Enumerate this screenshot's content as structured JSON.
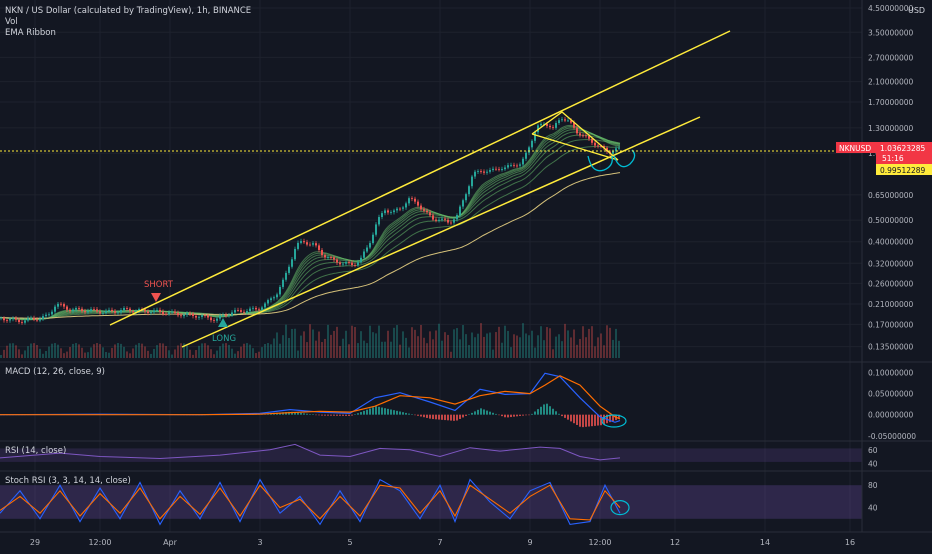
{
  "header": {
    "symbol_line": "NKN / US Dollar (calculated by TradingView), 1h, BINANCE",
    "vol_label": "Vol",
    "ema_label": "EMA Ribbon",
    "currency": "USD"
  },
  "indicators": {
    "macd_label": "MACD (12, 26, close, 9)",
    "rsi_label": "RSI (14, close)",
    "stoch_label": "Stoch RSI (3, 3, 14, 14, close)"
  },
  "annotations": {
    "short_label": "SHORT",
    "long_label": "LONG"
  },
  "price_badges": {
    "ticker": "NKNUSD",
    "price": "1.03623285",
    "countdown": "51:16",
    "ema_value": "0.99512289"
  },
  "colors": {
    "background": "#131722",
    "up": "#26a69a",
    "down": "#ef5350",
    "channel": "#ffeb3b",
    "ribbon": "#66bb6a",
    "macd": "#2962ff",
    "signal": "#ff6d00",
    "rsi": "#7e57c2",
    "stoch_k": "#2962ff",
    "stoch_d": "#ff6d00",
    "circle": "#00bcd4",
    "price_badge": "#f23645"
  },
  "chart_data": [
    {
      "type": "candlestick",
      "yscale": "log",
      "ylim": [
        0.12,
        4.5
      ],
      "y_ticks": [
        "4.50000000",
        "3.50000000",
        "2.70000000",
        "2.10000000",
        "1.70000000",
        "1.30000000",
        "1.00000000",
        "0.65000000",
        "0.50000000",
        "0.40000000",
        "0.32000000",
        "0.26000000",
        "0.21000000",
        "0.17000000",
        "0.13500000"
      ],
      "x_ticks": [
        "29",
        "12:00",
        "Apr",
        "3",
        "5",
        "7",
        "9",
        "12:00",
        "12",
        "14",
        "16"
      ],
      "series": [
        {
          "name": "NKNUSD",
          "points": [
            [
              0,
              0.182
            ],
            [
              10,
              0.178
            ],
            [
              22,
              0.176
            ],
            [
              33,
              0.18
            ],
            [
              40,
              0.181
            ],
            [
              47,
              0.186
            ],
            [
              55,
              0.21
            ],
            [
              62,
              0.204
            ],
            [
              70,
              0.198
            ],
            [
              82,
              0.197
            ],
            [
              95,
              0.195
            ],
            [
              105,
              0.193
            ],
            [
              115,
              0.195
            ],
            [
              125,
              0.198
            ],
            [
              135,
              0.196
            ],
            [
              148,
              0.195
            ],
            [
              160,
              0.193
            ],
            [
              172,
              0.19
            ],
            [
              184,
              0.188
            ],
            [
              196,
              0.186
            ],
            [
              208,
              0.182
            ],
            [
              215,
              0.178
            ],
            [
              222,
              0.186
            ],
            [
              232,
              0.193
            ],
            [
              244,
              0.196
            ],
            [
              256,
              0.199
            ],
            [
              266,
              0.212
            ],
            [
              276,
              0.236
            ],
            [
              283,
              0.27
            ],
            [
              290,
              0.33
            ],
            [
              295,
              0.385
            ],
            [
              302,
              0.4
            ],
            [
              312,
              0.39
            ],
            [
              322,
              0.35
            ],
            [
              332,
              0.33
            ],
            [
              342,
              0.32
            ],
            [
              352,
              0.315
            ],
            [
              360,
              0.335
            ],
            [
              368,
              0.39
            ],
            [
              376,
              0.49
            ],
            [
              384,
              0.56
            ],
            [
              392,
              0.54
            ],
            [
              400,
              0.57
            ],
            [
              408,
              0.62
            ],
            [
              416,
              0.6
            ],
            [
              424,
              0.54
            ],
            [
              432,
              0.51
            ],
            [
              440,
              0.5
            ],
            [
              448,
              0.49
            ],
            [
              456,
              0.52
            ],
            [
              464,
              0.65
            ],
            [
              472,
              0.8
            ],
            [
              480,
              0.84
            ],
            [
              488,
              0.82
            ],
            [
              496,
              0.86
            ],
            [
              504,
              0.85
            ],
            [
              512,
              0.9
            ],
            [
              520,
              0.88
            ],
            [
              528,
              1.08
            ],
            [
              536,
              1.3
            ],
            [
              544,
              1.38
            ],
            [
              552,
              1.28
            ],
            [
              560,
              1.46
            ],
            [
              568,
              1.38
            ],
            [
              576,
              1.25
            ],
            [
              584,
              1.18
            ],
            [
              592,
              1.12
            ],
            [
              600,
              1.06
            ],
            [
              608,
              1.01
            ],
            [
              614,
              1.04
            ],
            [
              620,
              1.036
            ]
          ]
        }
      ]
    },
    {
      "type": "line",
      "name": "MACD (12, 26, close, 9)",
      "ylim": [
        -0.06,
        0.12
      ],
      "y_ticks": [
        "0.10000000",
        "0.05000000",
        "0.00000000",
        "-0.05000000"
      ],
      "series": [
        {
          "name": "MACD",
          "points": [
            [
              0,
              0.0
            ],
            [
              100,
              0.001
            ],
            [
              200,
              0.0
            ],
            [
              260,
              0.003
            ],
            [
              290,
              0.012
            ],
            [
              320,
              0.006
            ],
            [
              350,
              0.003
            ],
            [
              375,
              0.04
            ],
            [
              400,
              0.052
            ],
            [
              430,
              0.03
            ],
            [
              455,
              0.01
            ],
            [
              480,
              0.06
            ],
            [
              505,
              0.048
            ],
            [
              530,
              0.05
            ],
            [
              545,
              0.098
            ],
            [
              560,
              0.09
            ],
            [
              580,
              0.04
            ],
            [
              600,
              -0.005
            ],
            [
              615,
              -0.018
            ],
            [
              620,
              -0.014
            ]
          ]
        },
        {
          "name": "Signal",
          "points": [
            [
              0,
              0.0
            ],
            [
              100,
              0.0
            ],
            [
              200,
              0.0
            ],
            [
              260,
              0.001
            ],
            [
              290,
              0.005
            ],
            [
              320,
              0.008
            ],
            [
              350,
              0.006
            ],
            [
              375,
              0.02
            ],
            [
              400,
              0.045
            ],
            [
              430,
              0.04
            ],
            [
              455,
              0.025
            ],
            [
              480,
              0.045
            ],
            [
              505,
              0.055
            ],
            [
              530,
              0.05
            ],
            [
              545,
              0.07
            ],
            [
              560,
              0.092
            ],
            [
              580,
              0.07
            ],
            [
              600,
              0.02
            ],
            [
              615,
              -0.005
            ],
            [
              620,
              -0.01
            ]
          ]
        }
      ]
    },
    {
      "type": "line",
      "name": "RSI (14, close)",
      "ylim": [
        30,
        70
      ],
      "y_ticks": [
        "60",
        "40"
      ],
      "series": [
        {
          "name": "RSI",
          "points": [
            [
              0,
              48
            ],
            [
              60,
              55
            ],
            [
              100,
              50
            ],
            [
              160,
              47
            ],
            [
              220,
              52
            ],
            [
              270,
              60
            ],
            [
              295,
              68
            ],
            [
              320,
              52
            ],
            [
              350,
              50
            ],
            [
              380,
              62
            ],
            [
              410,
              60
            ],
            [
              440,
              50
            ],
            [
              470,
              63
            ],
            [
              500,
              58
            ],
            [
              540,
              64
            ],
            [
              560,
              62
            ],
            [
              580,
              50
            ],
            [
              600,
              45
            ],
            [
              620,
              48
            ]
          ]
        }
      ]
    },
    {
      "type": "line",
      "name": "Stoch RSI (3, 3, 14, 14, close)",
      "ylim": [
        0,
        100
      ],
      "y_ticks": [
        "80",
        "40"
      ],
      "series": [
        {
          "name": "K",
          "points": [
            [
              0,
              30
            ],
            [
              20,
              70
            ],
            [
              40,
              20
            ],
            [
              60,
              80
            ],
            [
              80,
              15
            ],
            [
              100,
              75
            ],
            [
              120,
              20
            ],
            [
              140,
              85
            ],
            [
              160,
              10
            ],
            [
              180,
              70
            ],
            [
              200,
              20
            ],
            [
              220,
              85
            ],
            [
              240,
              15
            ],
            [
              260,
              90
            ],
            [
              280,
              30
            ],
            [
              300,
              60
            ],
            [
              320,
              10
            ],
            [
              340,
              70
            ],
            [
              360,
              15
            ],
            [
              380,
              90
            ],
            [
              400,
              70
            ],
            [
              420,
              20
            ],
            [
              440,
              80
            ],
            [
              455,
              15
            ],
            [
              470,
              90
            ],
            [
              490,
              50
            ],
            [
              510,
              20
            ],
            [
              530,
              70
            ],
            [
              550,
              85
            ],
            [
              570,
              10
            ],
            [
              590,
              15
            ],
            [
              605,
              80
            ],
            [
              620,
              30
            ]
          ]
        },
        {
          "name": "D",
          "points": [
            [
              0,
              35
            ],
            [
              20,
              60
            ],
            [
              40,
              30
            ],
            [
              60,
              70
            ],
            [
              80,
              25
            ],
            [
              100,
              65
            ],
            [
              120,
              30
            ],
            [
              140,
              75
            ],
            [
              160,
              20
            ],
            [
              180,
              60
            ],
            [
              200,
              28
            ],
            [
              220,
              75
            ],
            [
              240,
              25
            ],
            [
              260,
              80
            ],
            [
              280,
              40
            ],
            [
              300,
              55
            ],
            [
              320,
              20
            ],
            [
              340,
              60
            ],
            [
              360,
              25
            ],
            [
              380,
              80
            ],
            [
              400,
              75
            ],
            [
              420,
              30
            ],
            [
              440,
              70
            ],
            [
              455,
              25
            ],
            [
              470,
              80
            ],
            [
              490,
              55
            ],
            [
              510,
              30
            ],
            [
              530,
              60
            ],
            [
              550,
              80
            ],
            [
              570,
              20
            ],
            [
              590,
              18
            ],
            [
              605,
              70
            ],
            [
              620,
              40
            ]
          ]
        }
      ]
    }
  ]
}
